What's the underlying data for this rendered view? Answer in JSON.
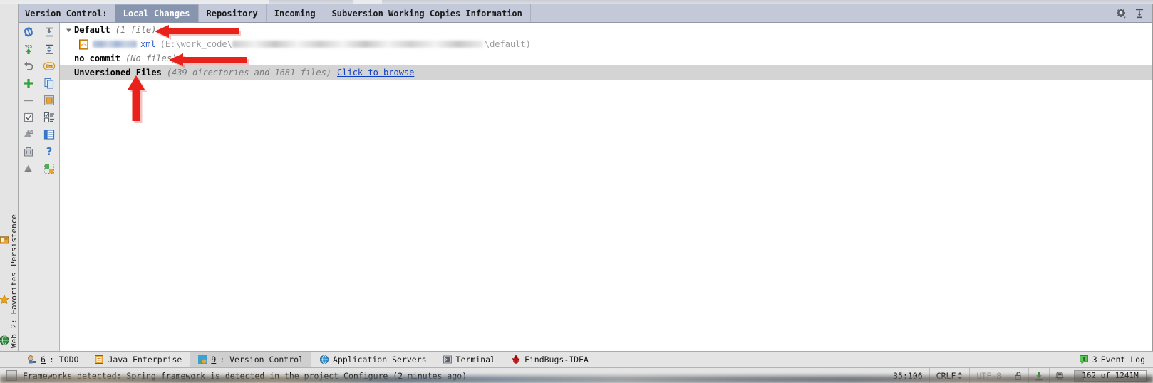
{
  "window": {
    "panel_title": "Version Control:",
    "tabs": [
      {
        "label": "Local Changes",
        "active": true
      },
      {
        "label": "Repository",
        "active": false
      },
      {
        "label": "Incoming",
        "active": false
      },
      {
        "label": "Subversion Working Copies Information",
        "active": false
      }
    ],
    "header_buttons": [
      {
        "name": "settings-gear-icon",
        "title": "Settings"
      },
      {
        "name": "hide-panel-icon",
        "title": "Hide"
      }
    ]
  },
  "left_rail": {
    "items": [
      {
        "label": "Persistence",
        "icon": "persistence-icon"
      },
      {
        "label": "2: Favorites",
        "icon": "favorites-star-icon"
      },
      {
        "label": "Web",
        "icon": "web-icon"
      }
    ]
  },
  "toolbar": {
    "buttons": [
      {
        "name": "refresh-button",
        "title": "Refresh"
      },
      {
        "name": "expand-all-button",
        "title": "Expand All"
      },
      {
        "name": "commit-changes-button",
        "title": "Commit Changes"
      },
      {
        "name": "collapse-all-button",
        "title": "Collapse All"
      },
      {
        "name": "rollback-button",
        "title": "Rollback"
      },
      {
        "name": "group-by-directory-button",
        "title": "Group By Directory"
      },
      {
        "name": "new-changelist-button",
        "title": "New Changelist"
      },
      {
        "name": "show-diff-button",
        "title": "Show Diff"
      },
      {
        "name": "delete-changelist-button",
        "title": "Delete Changelist"
      },
      {
        "name": "move-to-another-changelist-button",
        "title": "Move To Another Changelist"
      },
      {
        "name": "set-active-changelist-button",
        "title": "Set Active Changelist"
      },
      {
        "name": "select-checkboxes-button",
        "title": "Select / Unselect"
      },
      {
        "name": "shelve-changes-button",
        "title": "Shelve Silently"
      },
      {
        "name": "preview-diff-button",
        "title": "Preview Diff"
      },
      {
        "name": "revert-button",
        "title": "Revert"
      },
      {
        "name": "help-button",
        "title": "Help"
      },
      {
        "name": "shelf-button",
        "title": "Shelf"
      },
      {
        "name": "ignore-files-button",
        "title": "Configure Ignored Files"
      }
    ]
  },
  "changes": {
    "changelists": [
      {
        "name": "Default",
        "count": "(1 file)",
        "expanded": true,
        "selected": false,
        "files": [
          {
            "name_redacted": true,
            "extension": "xml",
            "path_prefix": "(E:\\work_code\\",
            "path_middle_redacted": true,
            "path_suffix": "\\default)"
          }
        ]
      },
      {
        "name": "no commit",
        "count": "(No files)",
        "expanded": false,
        "selected": false,
        "files": []
      }
    ],
    "unversioned": {
      "name": "Unversioned Files",
      "count": "(439 directories and 1681 files)",
      "link": "Click to browse",
      "selected": true
    }
  },
  "tool_windows": {
    "items": [
      {
        "shortcut": "6",
        "label": ": TODO",
        "icon": "todo-icon",
        "active": false
      },
      {
        "shortcut": "",
        "label": "Java Enterprise",
        "icon": "java-enterprise-icon",
        "active": false
      },
      {
        "shortcut": "9",
        "label": ": Version Control",
        "icon": "version-control-icon",
        "active": true
      },
      {
        "shortcut": "",
        "label": "Application Servers",
        "icon": "application-servers-icon",
        "active": false
      },
      {
        "shortcut": "",
        "label": "Terminal",
        "icon": "terminal-icon",
        "active": false
      },
      {
        "shortcut": "",
        "label": "FindBugs-IDEA",
        "icon": "findbugs-icon",
        "active": false
      }
    ],
    "event_log": {
      "count": "3",
      "label": "Event Log",
      "icon": "event-log-icon"
    }
  },
  "status_bar": {
    "message": "Frameworks detected: Spring framework is detected in the project Configure (2 minutes ago)",
    "caret_position": "35:106",
    "line_separator": "CRLF",
    "encoding": "UTF-8",
    "lock_icon": "unlocked-icon",
    "download_icon": "download-icon",
    "train_icon": "train-icon",
    "memory": {
      "label": "162 of 1241M",
      "used_percent": 13
    }
  },
  "annotations": {
    "arrows": [
      {
        "name": "arrow-default-changelist",
        "direction": "left"
      },
      {
        "name": "arrow-no-commit-changelist",
        "direction": "left"
      },
      {
        "name": "arrow-unversioned-files",
        "direction": "up"
      }
    ],
    "color": "#e8211a"
  }
}
